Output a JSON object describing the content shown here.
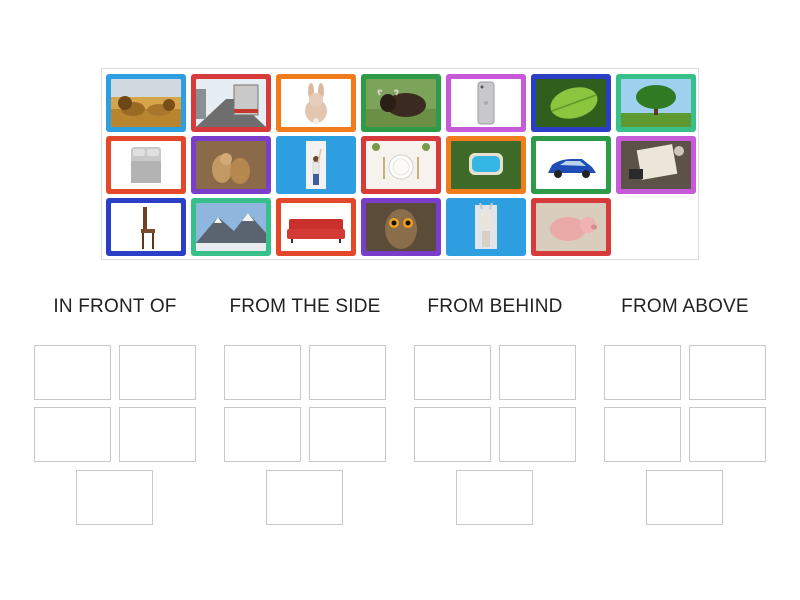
{
  "groups": [
    {
      "heading": "IN FRONT OF"
    },
    {
      "heading": "FROM THE SIDE"
    },
    {
      "heading": "FROM BEHIND"
    },
    {
      "heading": "FROM ABOVE"
    }
  ],
  "cards": [
    {
      "image": "lions-photo",
      "border": "#2d9fe0"
    },
    {
      "image": "truck-rear-photo",
      "border": "#d63a3a"
    },
    {
      "image": "rabbit-back-photo",
      "border": "#f07c1e"
    },
    {
      "image": "bull-photo",
      "border": "#2e9b48"
    },
    {
      "image": "smartphone-back-photo",
      "border": "#c65ad8"
    },
    {
      "image": "leaf-photo",
      "border": "#2a3fc6"
    },
    {
      "image": "tree-photo",
      "border": "#37c08a"
    },
    {
      "image": "bed-photo",
      "border": "#e4482a"
    },
    {
      "image": "prairie-dogs-photo",
      "border": "#7b3dcc"
    },
    {
      "image": "boy-at-wall-photo",
      "border": "#2d9fe0"
    },
    {
      "image": "table-setting-photo",
      "border": "#d63a3a"
    },
    {
      "image": "pool-aerial-photo",
      "border": "#f07c1e"
    },
    {
      "image": "blue-car-photo",
      "border": "#2e9b48"
    },
    {
      "image": "desk-map-photo",
      "border": "#c65ad8"
    },
    {
      "image": "chair-photo",
      "border": "#2a3fc6"
    },
    {
      "image": "mountain-photo",
      "border": "#37c08a"
    },
    {
      "image": "red-sofa-photo",
      "border": "#e4482a"
    },
    {
      "image": "owl-photo",
      "border": "#7b3dcc"
    },
    {
      "image": "horse-front-photo",
      "border": "#2d9fe0"
    },
    {
      "image": "pig-photo",
      "border": "#d63a3a"
    }
  ]
}
